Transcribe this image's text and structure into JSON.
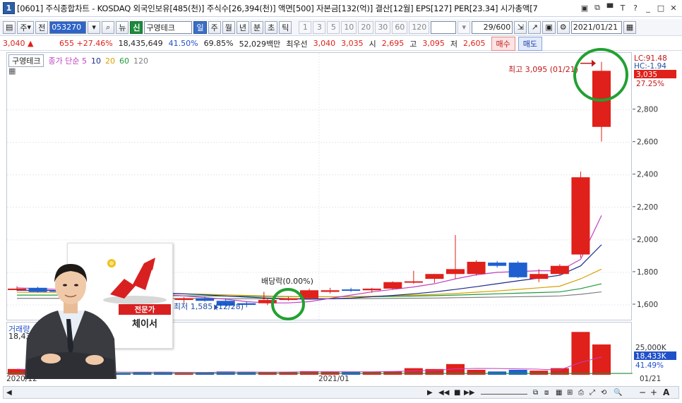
{
  "window": {
    "number": "1",
    "title": "[0601] 주식종합차트 - KOSDAQ 외국인보유[485(천)] 주식수[26,394(천)] 액면[500] 자본금[132(억)] 결산[12월] EPS[127] PER[23.34] 시가총액[7",
    "controls": [
      "▣",
      "⧉",
      "▀",
      "T",
      "?",
      "_",
      "□",
      "✕"
    ]
  },
  "toolbar": {
    "type_label": "주",
    "prev_label": "전",
    "code": "053270",
    "news_label": "뉴",
    "sin_label": "신",
    "stock_name": "구영테크",
    "periods": [
      "일",
      "주",
      "월",
      "년",
      "분",
      "초",
      "틱"
    ],
    "period_selected": "일",
    "intervals": [
      "1",
      "3",
      "5",
      "10",
      "20",
      "30",
      "60",
      "120"
    ],
    "count": "29/600",
    "date": "2021/01/21"
  },
  "quote": {
    "price": "3,040",
    "arrow": "▲",
    "change": "655",
    "change_pct": "+27.46%",
    "volume": "18,435,649",
    "ratio1": "41.50%",
    "ratio2": "69.85%",
    "amount": "52,029백만",
    "best_bid_label": "최우선",
    "best_bid1": "3,040",
    "best_bid2": "3,035",
    "open_label": "시",
    "open": "2,695",
    "high_label": "고",
    "high": "3,095",
    "low_label": "저",
    "low": "2,605",
    "buy_label": "매수",
    "sell_label": "매도"
  },
  "legend": {
    "name": "구영테크",
    "ma_label": "종가 단순 5",
    "ma_periods": [
      "10",
      "20",
      "60",
      "120"
    ]
  },
  "scale": {
    "lc": "LC:91.48",
    "hc": "HC:-1.94",
    "current": "3,035",
    "pct": "27.25%",
    "ticks": [
      "2,800",
      "2,600",
      "2,400",
      "2,200",
      "2,000",
      "1,800",
      "1,600"
    ],
    "vol_ticks": [
      "25,000K"
    ],
    "vol_current": "18,433K",
    "vol_pct": "41.49%"
  },
  "annotations": {
    "high": "최고 3,095 (01/21)",
    "low": "최저 1,585 (12/28)",
    "dividend": "배당락(0.00%)"
  },
  "volume_panel": {
    "label": "거래량",
    "value": "18,432"
  },
  "dates": {
    "left": "2020/12",
    "middle": "2021/01",
    "right": "01/21"
  },
  "promo": {
    "tag": "전문가",
    "name": "체이서"
  },
  "colors": {
    "up": "#e0201a",
    "down": "#1f5fd0",
    "ma5": "#c040c0",
    "ma10": "#1a2a8a",
    "ma20": "#d8a000",
    "ma60": "#1e9a3c",
    "ma120": "#808080",
    "highlight": "#22a032"
  },
  "chart_data": {
    "type": "candlestick",
    "ylim": [
      1500,
      3150
    ],
    "candles": [
      {
        "o": 1700,
        "h": 1715,
        "l": 1685,
        "c": 1700,
        "up": true
      },
      {
        "o": 1705,
        "h": 1712,
        "l": 1675,
        "c": 1680,
        "up": false
      },
      {
        "o": 1690,
        "h": 1700,
        "l": 1672,
        "c": 1685,
        "up": false
      },
      {
        "o": 1685,
        "h": 1695,
        "l": 1665,
        "c": 1670,
        "up": false
      },
      {
        "o": 1675,
        "h": 1690,
        "l": 1660,
        "c": 1680,
        "up": true
      },
      {
        "o": 1680,
        "h": 1690,
        "l": 1655,
        "c": 1660,
        "up": false
      },
      {
        "o": 1662,
        "h": 1672,
        "l": 1640,
        "c": 1648,
        "up": false
      },
      {
        "o": 1648,
        "h": 1658,
        "l": 1620,
        "c": 1625,
        "up": false
      },
      {
        "o": 1630,
        "h": 1648,
        "l": 1610,
        "c": 1640,
        "up": true
      },
      {
        "o": 1640,
        "h": 1650,
        "l": 1620,
        "c": 1625,
        "up": false
      },
      {
        "o": 1625,
        "h": 1640,
        "l": 1590,
        "c": 1595,
        "up": false
      },
      {
        "o": 1610,
        "h": 1620,
        "l": 1585,
        "c": 1600,
        "up": false
      },
      {
        "o": 1630,
        "h": 1640,
        "l": 1598,
        "c": 1610,
        "up": true
      },
      {
        "o": 1640,
        "h": 1650,
        "l": 1625,
        "c": 1630,
        "up": true
      },
      {
        "o": 1640,
        "h": 1700,
        "l": 1635,
        "c": 1690,
        "up": true
      },
      {
        "o": 1680,
        "h": 1705,
        "l": 1670,
        "c": 1690,
        "up": true
      },
      {
        "o": 1695,
        "h": 1705,
        "l": 1680,
        "c": 1690,
        "up": false
      },
      {
        "o": 1690,
        "h": 1705,
        "l": 1675,
        "c": 1700,
        "up": true
      },
      {
        "o": 1700,
        "h": 1745,
        "l": 1695,
        "c": 1740,
        "up": true
      },
      {
        "o": 1740,
        "h": 1810,
        "l": 1730,
        "c": 1745,
        "up": true
      },
      {
        "o": 1760,
        "h": 1790,
        "l": 1735,
        "c": 1790,
        "up": true
      },
      {
        "o": 1790,
        "h": 2030,
        "l": 1760,
        "c": 1820,
        "up": true
      },
      {
        "o": 1790,
        "h": 1875,
        "l": 1780,
        "c": 1865,
        "up": true
      },
      {
        "o": 1860,
        "h": 1870,
        "l": 1830,
        "c": 1840,
        "up": false
      },
      {
        "o": 1860,
        "h": 1870,
        "l": 1765,
        "c": 1770,
        "up": false
      },
      {
        "o": 1760,
        "h": 1820,
        "l": 1740,
        "c": 1790,
        "up": true
      },
      {
        "o": 1790,
        "h": 1850,
        "l": 1780,
        "c": 1840,
        "up": true
      },
      {
        "o": 1910,
        "h": 2420,
        "l": 1890,
        "c": 2385,
        "up": true
      },
      {
        "o": 2695,
        "h": 3095,
        "l": 2605,
        "c": 3040,
        "up": true
      }
    ],
    "volumes": [
      3.5,
      1.5,
      2.0,
      1.5,
      1.8,
      1.2,
      1.5,
      1.8,
      1.2,
      1.5,
      2.0,
      1.8,
      1.6,
      1.5,
      2.2,
      2.0,
      1.8,
      1.7,
      2.2,
      4.0,
      3.5,
      6.5,
      3.0,
      2.0,
      3.0,
      2.5,
      4.0,
      26.0,
      18.4
    ],
    "ma5": [
      1705,
      1700,
      1695,
      1690,
      1685,
      1680,
      1672,
      1664,
      1655,
      1645,
      1635,
      1620,
      1612,
      1612,
      1620,
      1640,
      1660,
      1680,
      1695,
      1710,
      1730,
      1760,
      1785,
      1800,
      1805,
      1810,
      1810,
      1880,
      2150
    ],
    "ma10": [
      1690,
      1690,
      1688,
      1686,
      1684,
      1680,
      1676,
      1672,
      1668,
      1662,
      1655,
      1648,
      1642,
      1638,
      1635,
      1638,
      1642,
      1650,
      1658,
      1668,
      1680,
      1695,
      1712,
      1730,
      1748,
      1765,
      1782,
      1840,
      1970
    ],
    "ma20": [
      1678,
      1678,
      1677,
      1676,
      1675,
      1674,
      1672,
      1670,
      1668,
      1665,
      1662,
      1658,
      1655,
      1652,
      1650,
      1650,
      1651,
      1653,
      1656,
      1660,
      1664,
      1670,
      1678,
      1686,
      1695,
      1705,
      1715,
      1760,
      1820
    ],
    "ma60": [
      1660,
      1660,
      1660,
      1659,
      1659,
      1658,
      1658,
      1657,
      1656,
      1655,
      1654,
      1653,
      1652,
      1651,
      1650,
      1650,
      1650,
      1651,
      1652,
      1654,
      1657,
      1660,
      1664,
      1668,
      1672,
      1676,
      1680,
      1700,
      1730
    ],
    "ma120": [
      1640,
      1640,
      1640,
      1640,
      1640,
      1640,
      1640,
      1639,
      1639,
      1639,
      1638,
      1638,
      1638,
      1638,
      1638,
      1638,
      1638,
      1639,
      1640,
      1641,
      1642,
      1644,
      1646,
      1648,
      1650,
      1652,
      1655,
      1665,
      1680
    ]
  }
}
